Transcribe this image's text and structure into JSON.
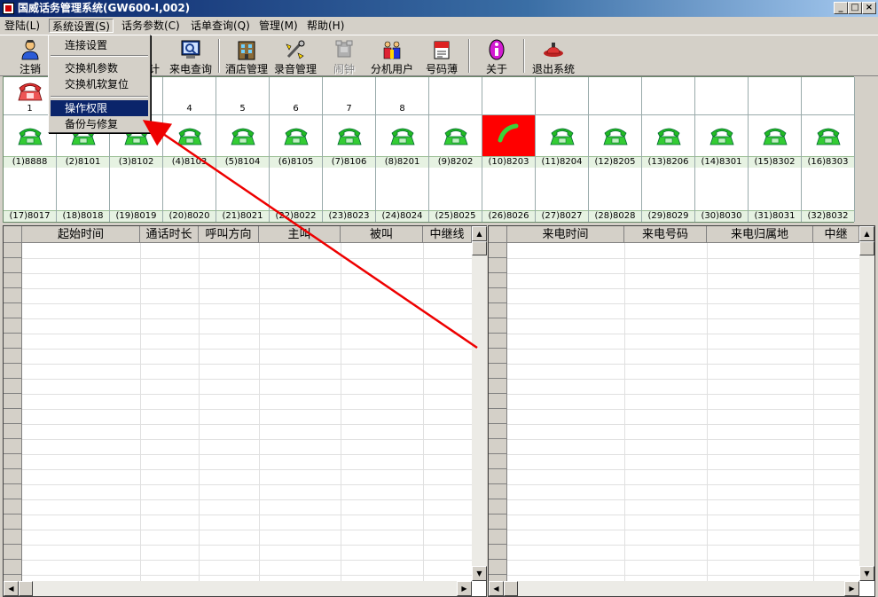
{
  "window": {
    "title": "国威话务管理系统(GW600-I,002)"
  },
  "menubar": [
    {
      "label": "登陆(L)"
    },
    {
      "label": "系统设置(S)"
    },
    {
      "label": "话务参数(C)"
    },
    {
      "label": "话单查询(Q)"
    },
    {
      "label": "管理(M)"
    },
    {
      "label": "帮助(H)"
    }
  ],
  "dropdown": {
    "items": [
      "连接设置",
      "交换机参数",
      "交换机软复位",
      "操作权限",
      "备份与修复"
    ],
    "highlighted": "操作权限"
  },
  "toolbar": {
    "items": [
      {
        "label": "注销",
        "icon": "user-icon"
      },
      {
        "label": "计",
        "icon": "calc-icon"
      },
      {
        "label": "来电查询",
        "icon": "phone-query-icon"
      },
      {
        "label": "酒店管理",
        "icon": "hotel-icon"
      },
      {
        "label": "录音管理",
        "icon": "record-icon"
      },
      {
        "label": "闹钟",
        "icon": "alarm-icon"
      },
      {
        "label": "分机用户",
        "icon": "users-icon"
      },
      {
        "label": "号码薄",
        "icon": "phonebook-icon"
      },
      {
        "label": "关于",
        "icon": "info-icon"
      },
      {
        "label": "退出系统",
        "icon": "exit-icon"
      }
    ]
  },
  "trunks": [
    "1",
    "4",
    "5",
    "6",
    "7",
    "8"
  ],
  "extensions_row1": [
    "(1)8888",
    "(2)8101",
    "(3)8102",
    "(4)8103",
    "(5)8104",
    "(6)8105",
    "(7)8106",
    "(8)8201",
    "(9)8202",
    "(10)8203",
    "(11)8204",
    "(12)8205",
    "(13)8206",
    "(14)8301",
    "(15)8302",
    "(16)8303"
  ],
  "extensions_row2": [
    "(17)8017",
    "(18)8018",
    "(19)8019",
    "(20)8020",
    "(21)8021",
    "(22)8022",
    "(23)8023",
    "(24)8024",
    "(25)8025",
    "(26)8026",
    "(27)8027",
    "(28)8028",
    "(29)8029",
    "(30)8030",
    "(31)8031",
    "(32)8032"
  ],
  "call_table": {
    "columns": [
      "起始时间",
      "通话时长",
      "呼叫方向",
      "主叫",
      "被叫",
      "中继线"
    ]
  },
  "incoming_table": {
    "columns": [
      "来电时间",
      "来电号码",
      "来电归属地",
      "中继"
    ]
  },
  "colors": {
    "active_call": "#ff0000",
    "phone_green": "#33cc33",
    "highlight": "#0a246a"
  }
}
